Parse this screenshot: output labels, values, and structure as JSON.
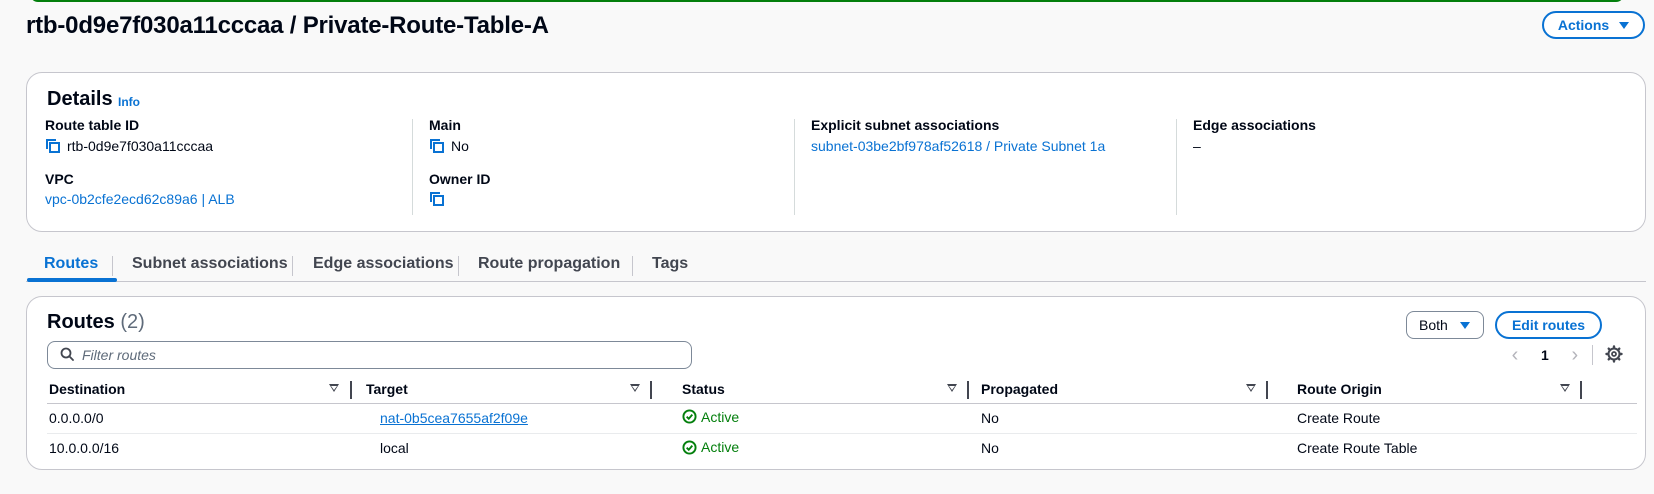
{
  "page": {
    "title": "rtb-0d9e7f030a11cccaa / Private-Route-Table-A",
    "actions_label": "Actions"
  },
  "details": {
    "title": "Details",
    "info_label": "Info",
    "route_table_id_label": "Route table ID",
    "route_table_id": "rtb-0d9e7f030a11cccaa",
    "main_label": "Main",
    "main_value": "No",
    "explicit_subnet_label": "Explicit subnet associations",
    "explicit_subnet_value": "subnet-03be2bf978af52618 / Private Subnet 1a",
    "edge_label": "Edge associations",
    "edge_value": "–",
    "vpc_label": "VPC",
    "vpc_value": "vpc-0b2cfe2ecd62c89a6 | ALB",
    "owner_label": "Owner ID",
    "owner_value": ""
  },
  "tabs": [
    {
      "label": "Routes",
      "active": true
    },
    {
      "label": "Subnet associations"
    },
    {
      "label": "Edge associations"
    },
    {
      "label": "Route propagation"
    },
    {
      "label": "Tags"
    }
  ],
  "routes": {
    "title": "Routes",
    "count": "(2)",
    "filter_selected": "Both",
    "edit_label": "Edit routes",
    "search_placeholder": "Filter routes",
    "page_number": "1",
    "columns": [
      "Destination",
      "Target",
      "Status",
      "Propagated",
      "Route Origin"
    ],
    "rows": [
      {
        "destination": "0.0.0.0/0",
        "target": "nat-0b5cea7655af2f09e",
        "status": "Active",
        "propagated": "No",
        "origin": "Create Route"
      },
      {
        "destination": "10.0.0.0/16",
        "target": "local",
        "status": "Active",
        "propagated": "No",
        "origin": "Create Route Table"
      }
    ]
  },
  "colors": {
    "link": "#0972d3",
    "success": "#037f0c",
    "text": "#000716"
  }
}
